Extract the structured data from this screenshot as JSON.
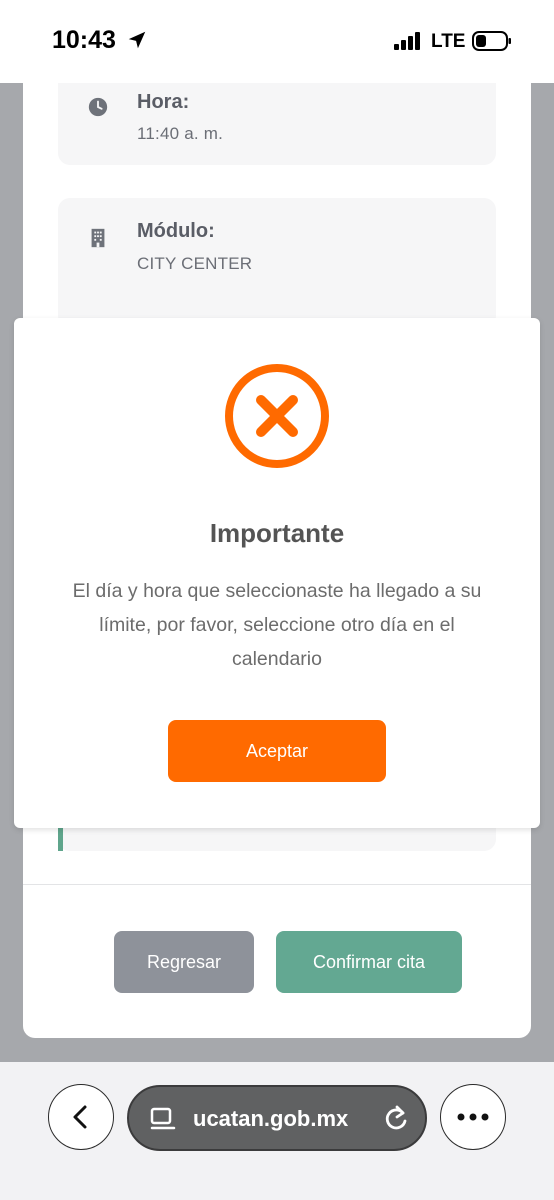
{
  "status_bar": {
    "time": "10:43",
    "network": "LTE"
  },
  "appointment": {
    "hora_label": "Hora:",
    "hora_value": "11:40 a. m.",
    "modulo_label": "Módulo:",
    "modulo_value": "CITY CENTER"
  },
  "actions": {
    "back_label": "Regresar",
    "confirm_label": "Confirmar cita"
  },
  "modal": {
    "title": "Importante",
    "message": "El día y hora que seleccionaste ha llegado a su límite, por favor, seleccione otro día en el calendario",
    "accept_label": "Aceptar",
    "icon": "error-x-icon",
    "accent_color": "#ff6a00"
  },
  "browser": {
    "url": "ucatan.gob.mx"
  },
  "colors": {
    "confirm": "#63a892",
    "back": "#8e929a",
    "overlay": "#a6a8ac"
  }
}
